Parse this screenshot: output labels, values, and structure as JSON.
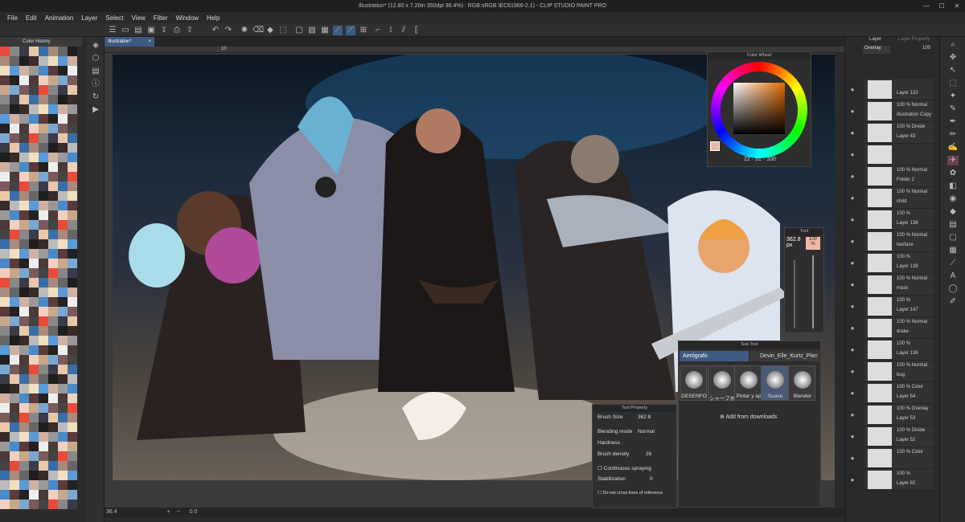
{
  "window": {
    "title": "Illustration* (12.80 x 7.20in 350dpi 36.4%) : RGB:sRGB IEC61966-2.1) - CLIP STUDIO PAINT PRO",
    "minimize": "—",
    "maximize": "☐",
    "close": "✕"
  },
  "menu": [
    "File",
    "Edit",
    "Animation",
    "Layer",
    "Select",
    "View",
    "Filter",
    "Window",
    "Help"
  ],
  "left": {
    "color_history_title": "Color History"
  },
  "tab": {
    "label": "Illustration*",
    "close": "×"
  },
  "ruler": {
    "mark": "10"
  },
  "status": {
    "zoom": "36.4",
    "rotation": "0.0"
  },
  "color_wheel": {
    "title": "Color Wheel",
    "h": "22",
    "s": "31",
    "v": "100"
  },
  "size_panel": {
    "title": "Tool",
    "size": "362.8",
    "unit": "px",
    "opacity": "100",
    "opacity_unit": "%"
  },
  "sub_tool": {
    "title": "Sub Tool",
    "tab1": "Aerógrafo",
    "tab2": "Devin_Elle_Kurtz_Plan",
    "brushes": [
      "DESENFO",
      "シャープ水",
      "Pintar y ap",
      "Suave",
      "Blender"
    ],
    "add": "Add from downloads"
  },
  "tool_property": {
    "title": "Tool Property",
    "brush_size_label": "Brush Size",
    "brush_size": "362.8",
    "blend_label": "Blending mode",
    "blend": "Normal",
    "hardness_label": "Hardness",
    "density_label": "Brush density",
    "density": "26",
    "spray": "Continuous spraying",
    "stab_label": "Stabilization",
    "stab": "0",
    "nocross": "Do not cross lines of reference"
  },
  "layer_panel": {
    "tab1": "Layer",
    "tab2": "Layer Property",
    "blend": "Overlay",
    "opacity": "100"
  },
  "layers": [
    {
      "mode": "",
      "name": "Layer 132"
    },
    {
      "mode": "100 % Normal",
      "name": "Illustration Copy"
    },
    {
      "mode": "100 % Divide",
      "name": "Layer 43"
    },
    {
      "mode": "",
      "name": ""
    },
    {
      "mode": "100 % Normal",
      "name": "Folder 2"
    },
    {
      "mode": "100 % Normal",
      "name": "child"
    },
    {
      "mode": "100 %",
      "name": "Layer 138"
    },
    {
      "mode": "100 % Normal",
      "name": "twoface"
    },
    {
      "mode": "100 %",
      "name": "Layer 139"
    },
    {
      "mode": "100 % Normal",
      "name": "mask"
    },
    {
      "mode": "100 %",
      "name": "Layer 147"
    },
    {
      "mode": "100 % Normal",
      "name": "drake"
    },
    {
      "mode": "100 %",
      "name": "Layer 136"
    },
    {
      "mode": "100 % Normal",
      "name": "bug"
    },
    {
      "mode": "100 % Color",
      "name": "Layer 54"
    },
    {
      "mode": "100 % Overlay",
      "name": "Layer 53"
    },
    {
      "mode": "100 % Divide",
      "name": "Layer 52"
    },
    {
      "mode": "100 % Color",
      "name": ""
    },
    {
      "mode": "100 %",
      "name": "Layer 82"
    }
  ]
}
